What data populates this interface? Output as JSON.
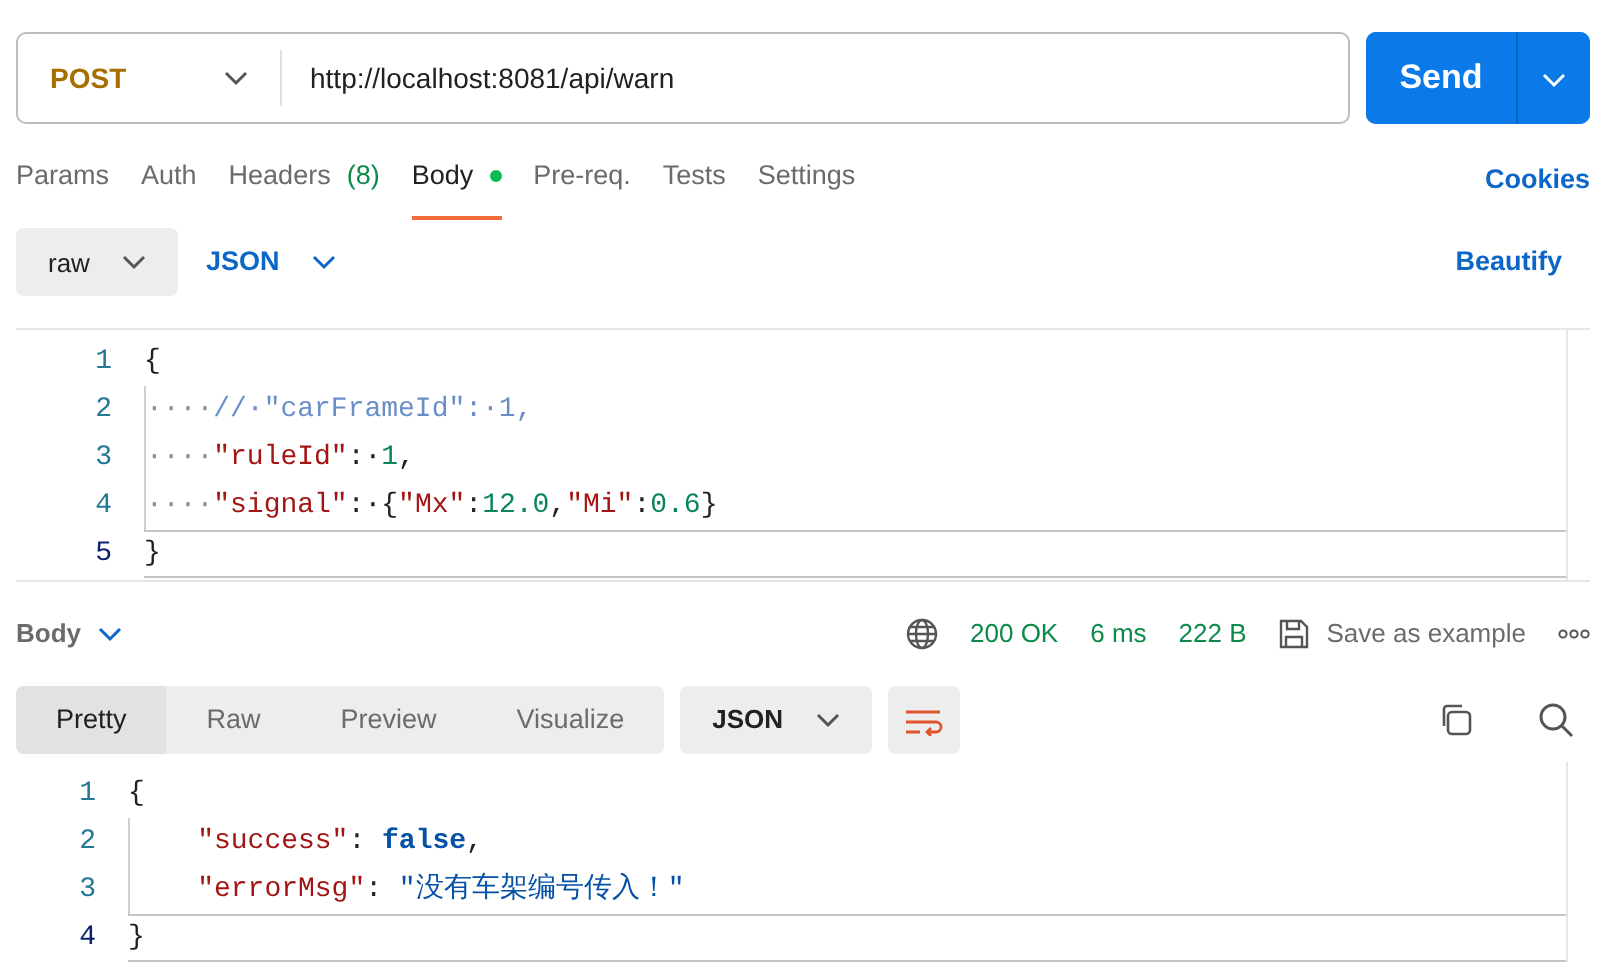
{
  "request": {
    "method": "POST",
    "url": "http://localhost:8081/api/warn",
    "send_label": "Send"
  },
  "tabs": [
    {
      "label": "Params",
      "indicator": false,
      "selected": false
    },
    {
      "label": "Auth",
      "indicator": false,
      "selected": false
    },
    {
      "label": "Headers",
      "count": "(8)",
      "indicator": false,
      "selected": false
    },
    {
      "label": "Body",
      "indicator": true,
      "selected": true
    },
    {
      "label": "Pre-req.",
      "indicator": false,
      "selected": false
    },
    {
      "label": "Tests",
      "indicator": false,
      "selected": false
    },
    {
      "label": "Settings",
      "indicator": false,
      "selected": false
    }
  ],
  "cookies_link": "Cookies",
  "body_options": {
    "mode": "raw",
    "language": "JSON",
    "beautify": "Beautify"
  },
  "request_editor": {
    "lines": [
      {
        "number": "1",
        "current": false,
        "tokens": [
          {
            "kind": "punct",
            "text": "{"
          }
        ]
      },
      {
        "number": "2",
        "current": false,
        "tokens": [
          {
            "kind": "space",
            "text": "····"
          },
          {
            "kind": "comment",
            "text": "//·\"carFrameId\":·1,"
          }
        ]
      },
      {
        "number": "3",
        "current": false,
        "tokens": [
          {
            "kind": "space",
            "text": "····"
          },
          {
            "kind": "key",
            "text": "\"ruleId\""
          },
          {
            "kind": "punct",
            "text": ":·"
          },
          {
            "kind": "number",
            "text": "1"
          },
          {
            "kind": "punct",
            "text": ","
          }
        ]
      },
      {
        "number": "4",
        "current": false,
        "tokens": [
          {
            "kind": "space",
            "text": "····"
          },
          {
            "kind": "key",
            "text": "\"signal\""
          },
          {
            "kind": "punct",
            "text": ":·{"
          },
          {
            "kind": "key",
            "text": "\"Mx\""
          },
          {
            "kind": "punct",
            "text": ":"
          },
          {
            "kind": "number",
            "text": "12.0"
          },
          {
            "kind": "punct",
            "text": ","
          },
          {
            "kind": "key",
            "text": "\"Mi\""
          },
          {
            "kind": "punct",
            "text": ":"
          },
          {
            "kind": "number",
            "text": "0.6"
          },
          {
            "kind": "punct",
            "text": "}"
          }
        ]
      },
      {
        "number": "5",
        "current": true,
        "tokens": [
          {
            "kind": "punct",
            "text": "}"
          }
        ]
      }
    ]
  },
  "response": {
    "section": "Body",
    "status": "200 OK",
    "time": "6 ms",
    "size": "222 B",
    "save": "Save as example",
    "views": [
      {
        "label": "Pretty",
        "selected": true
      },
      {
        "label": "Raw",
        "selected": false
      },
      {
        "label": "Preview",
        "selected": false
      },
      {
        "label": "Visualize",
        "selected": false
      }
    ],
    "format": "JSON",
    "lines": [
      {
        "number": "1",
        "current": false,
        "tokens": [
          {
            "kind": "punct",
            "text": "{"
          }
        ]
      },
      {
        "number": "2",
        "current": false,
        "tokens": [
          {
            "kind": "key",
            "text": "\"success\""
          },
          {
            "kind": "punct",
            "text": ": "
          },
          {
            "kind": "keyword",
            "text": "false"
          },
          {
            "kind": "punct",
            "text": ","
          }
        ]
      },
      {
        "number": "3",
        "current": false,
        "tokens": [
          {
            "kind": "key",
            "text": "\"errorMsg\""
          },
          {
            "kind": "punct",
            "text": ": "
          },
          {
            "kind": "string",
            "text": "\"没有车架编号传入！\""
          }
        ]
      },
      {
        "number": "4",
        "current": true,
        "tokens": [
          {
            "kind": "punct",
            "text": "}"
          }
        ]
      }
    ]
  }
}
